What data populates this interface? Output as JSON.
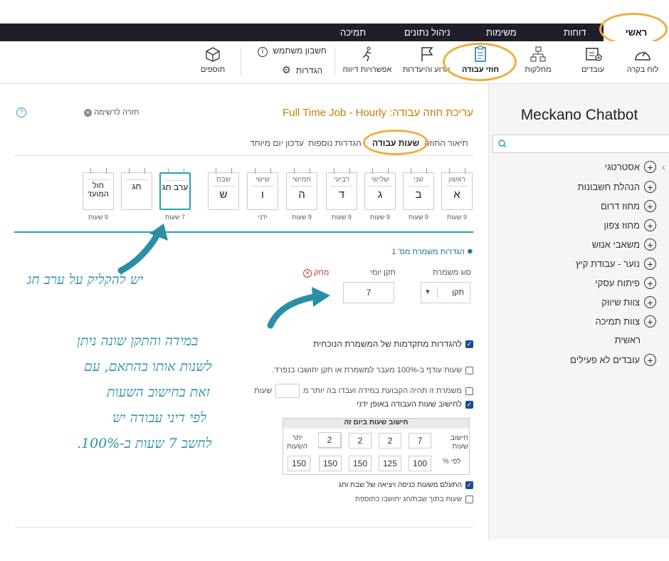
{
  "top_nav": {
    "items": [
      "ראשי",
      "דוחות",
      "משימות",
      "ניהול נתונים",
      "תמיכה"
    ]
  },
  "toolbar": {
    "tools": [
      {
        "label": "לוח בקרה",
        "icon": "speedometer-icon"
      },
      {
        "label": "עובדים",
        "icon": "employee-card-icon"
      },
      {
        "label": "מחלקות",
        "icon": "org-chart-icon"
      },
      {
        "label": "חוזי עבודה",
        "icon": "clipboard-icon"
      },
      {
        "label": "ארוע והיעדרות",
        "icon": "flag-icon"
      },
      {
        "label": "אפשרויות דיווח",
        "icon": "running-person-icon"
      },
      {
        "label": "תוספים",
        "icon": "package-icon"
      }
    ],
    "account_label": "חשבון משתמש",
    "settings_label": "הגדרות"
  },
  "sidebar": {
    "title": "Meckano Chatbot",
    "items": [
      {
        "label": "אסטרטגי",
        "expandable": true
      },
      {
        "label": "הנהלת חשבונות",
        "expandable": true
      },
      {
        "label": "מחוז דרום",
        "expandable": true
      },
      {
        "label": "מחוז צפון",
        "expandable": true
      },
      {
        "label": "משאבי אנוש",
        "expandable": true
      },
      {
        "label": "נוער - עבודת קיץ",
        "expandable": true
      },
      {
        "label": "פיתוח עסקי",
        "expandable": true
      },
      {
        "label": "צוות שיווק",
        "expandable": true
      },
      {
        "label": "צוות תמיכה",
        "expandable": true
      },
      {
        "label": "ראשית",
        "expandable": false
      },
      {
        "label": "עובדים לא פעילים",
        "expandable": true
      }
    ]
  },
  "header": {
    "title": "עריכת חוזה עבודה: Full Time Job - Hourly",
    "back_label": "חזרה לרשימה"
  },
  "tabs": [
    "תיאור החוזה",
    "שעות עבודה",
    "הגדרות נוספות",
    "עדכון יום מיוחד"
  ],
  "days": [
    {
      "name": "ראשון",
      "letter": "א",
      "hours": "9 שעות"
    },
    {
      "name": "שני",
      "letter": "ב",
      "hours": "9 שעות"
    },
    {
      "name": "שלישי",
      "letter": "ג",
      "hours": "9 שעות"
    },
    {
      "name": "רביעי",
      "letter": "ד",
      "hours": "9 שעות"
    },
    {
      "name": "חמישי",
      "letter": "ה",
      "hours": "9 שעות"
    },
    {
      "name": "שישי",
      "letter": "ו",
      "hours": "ידני"
    },
    {
      "name": "שבת",
      "letter": "ש",
      "hours": ""
    },
    {
      "name": "",
      "letter": "ערב חג",
      "hours": "7 שעות"
    },
    {
      "name": "",
      "letter": "חג",
      "hours": ""
    },
    {
      "name": "",
      "letter": "חול המועד",
      "hours": "9 שעות"
    }
  ],
  "shift": {
    "section_title": "הגדרות משמרת מס' 1",
    "type_label": "סוג משמרת",
    "type_value": "תקן",
    "daily_label": "תקן יומי",
    "daily_value": "7",
    "delete_label": "מחק"
  },
  "options": {
    "advanced": "להגדרות מתקדמות של המשמרת הנוכחית",
    "overtime": "שעות עודף ב-100% מעבר למשמרת או תקן יחושבו בנפרד.",
    "fixed_shift": "משמרת זו תהיה הקבועת במידה ועבדו בה יותר מ",
    "fixed_shift_suffix": "שעות",
    "manual_calc": "לחישוב שעות העבודה באופן ידני",
    "ignore_entry": "התעלם משעות כניסה ויציאה של שבת וחג",
    "inner_hours": "שעות בתוך שבת/חג יחושבו כתוספת"
  },
  "calc": {
    "title": "חישוב שעות ביום זה",
    "row1_label": "חישוב שעות",
    "row2_label": "לפי %",
    "rest_label": "יתר השעות",
    "hours": [
      "7",
      "2",
      "2",
      "2",
      "2"
    ],
    "percents": [
      "100",
      "125",
      "150",
      "150",
      "150"
    ]
  },
  "annotations": {
    "holiday_eve": "יש להקליק על ערב חג",
    "explain": [
      "במידה והתקן שונה ניתן",
      "לשנות אותו בהתאם, עם",
      "זאת בחישוב השעות",
      "לפי דיני עבודה יש",
      "לחשב 7 שעות ב-100%."
    ]
  },
  "colors": {
    "accent": "#23a3b4",
    "annotation": "#2a8fa6",
    "highlight_ring": "#f0ad3c",
    "title": "#c57f00"
  }
}
